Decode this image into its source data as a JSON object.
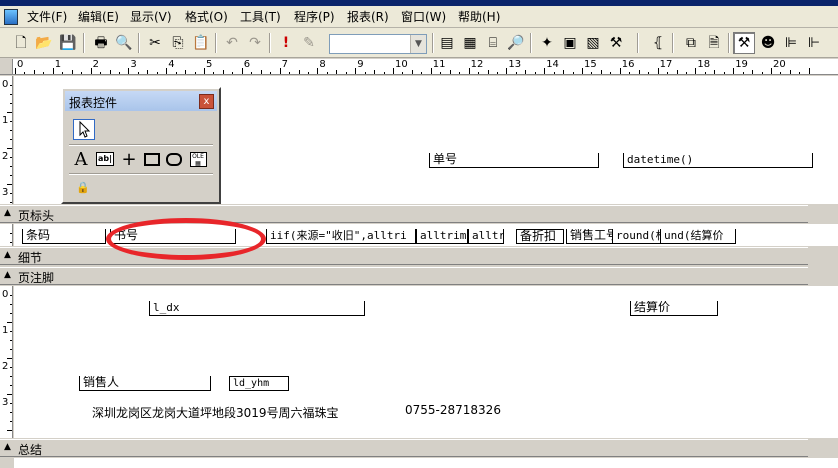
{
  "menu": [
    "文件(F)",
    "编辑(E)",
    "显示(V)",
    "格式(O)",
    "工具(T)",
    "程序(P)",
    "报表(R)",
    "窗口(W)",
    "帮助(H)"
  ],
  "toolbar": {
    "combo_value": ""
  },
  "ruler": {
    "numbers": [
      "0",
      "1",
      "2",
      "3",
      "4",
      "5",
      "6",
      "7",
      "8",
      "9",
      "10",
      "11",
      "12",
      "13",
      "14",
      "15",
      "16",
      "17",
      "18",
      "19",
      "20"
    ]
  },
  "palette": {
    "title": "报表控件",
    "close": "x"
  },
  "bands": {
    "page_header": "页标头",
    "detail": "细节",
    "page_footer": "页注脚",
    "summary": "总结"
  },
  "page_header_fields": {
    "bill_no": "单号",
    "datetime": "datetime()"
  },
  "detail_fields": {
    "barcode": "条码",
    "book_no": "书号",
    "iif": "iif(来源=\"收旧\",alltri",
    "alltrim1": "alltrim",
    "alltrim2": "alltri",
    "discount": "备折扣",
    "salary_no": "销售工号",
    "round1": "round(标",
    "round2": "und(结算价"
  },
  "footer_fields": {
    "l_dx": "l_dx",
    "settle_price": "结算价",
    "salesperson": "销售人",
    "ld_yhm": "ld_yhm",
    "address": "深圳龙岗区龙岗大道坪地段3019号周六福珠宝",
    "phone": "0755-28718326"
  }
}
